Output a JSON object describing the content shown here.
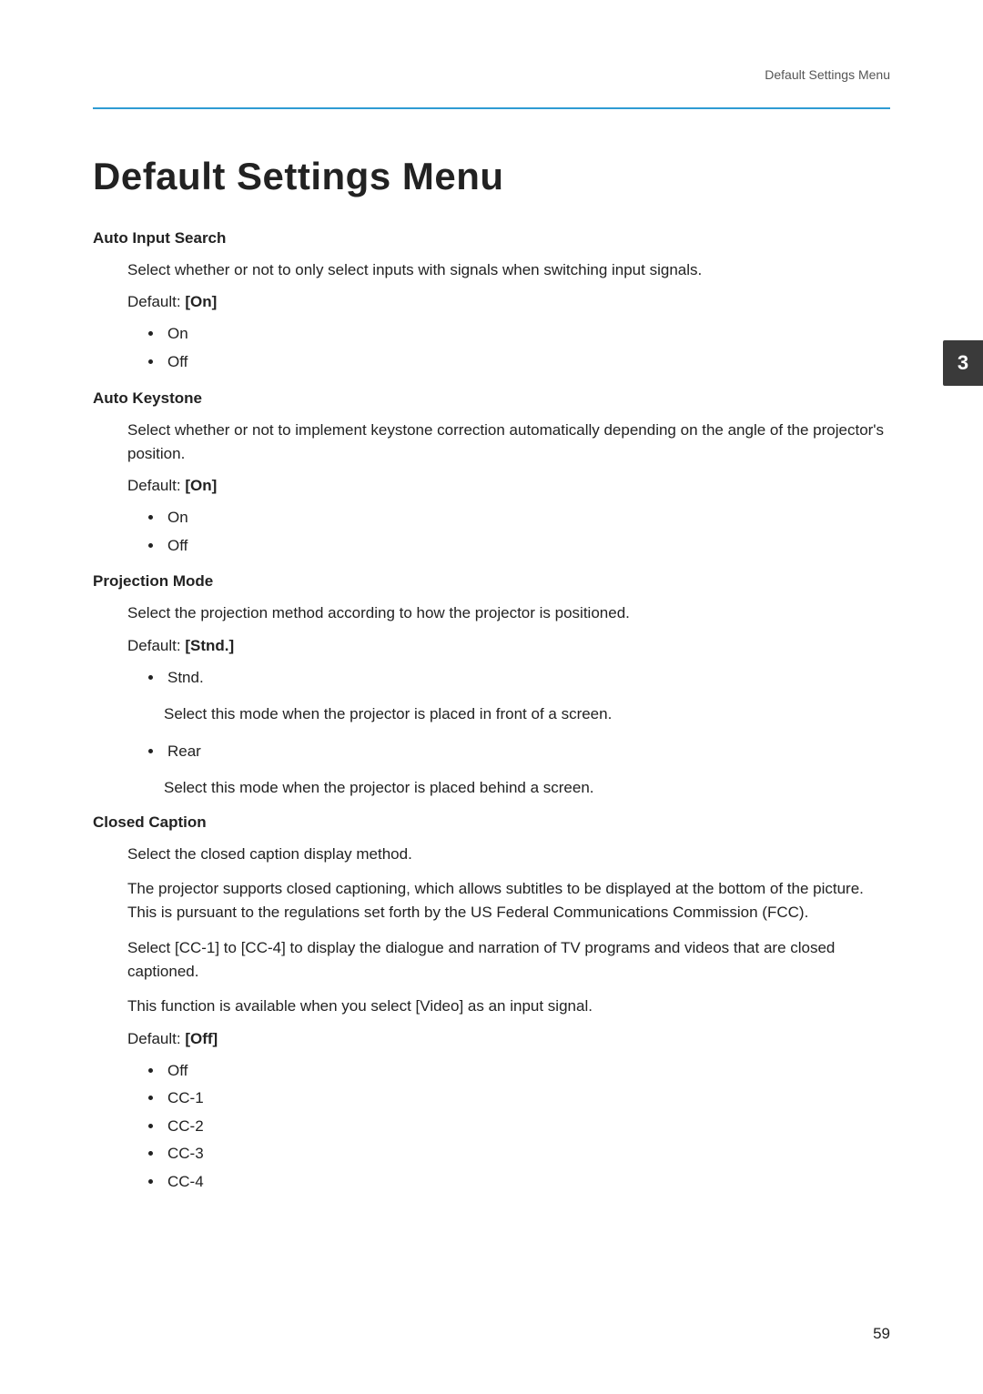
{
  "header": {
    "running_head": "Default Settings Menu"
  },
  "tab": {
    "label": "3"
  },
  "title": "Default Settings Menu",
  "sections": {
    "auto_input_search": {
      "heading": "Auto Input Search",
      "desc": "Select whether or not to only select inputs with signals when switching input signals.",
      "default_label": "Default: ",
      "default_value": "[On]",
      "opts": {
        "o1": "On",
        "o2": "Off"
      }
    },
    "auto_keystone": {
      "heading": "Auto Keystone",
      "desc": "Select whether or not to implement keystone correction automatically depending on the angle of the projector's position.",
      "default_label": "Default: ",
      "default_value": "[On]",
      "opts": {
        "o1": "On",
        "o2": "Off"
      }
    },
    "projection_mode": {
      "heading": "Projection Mode",
      "desc": "Select the projection method according to how the projector is positioned.",
      "default_label": "Default: ",
      "default_value": "[Stnd.]",
      "opts": {
        "o1": "Stnd.",
        "o1_desc": "Select this mode when the projector is placed in front of a screen.",
        "o2": "Rear",
        "o2_desc": "Select this mode when the projector is placed behind a screen."
      }
    },
    "closed_caption": {
      "heading": "Closed Caption",
      "p1": "Select the closed caption display method.",
      "p2": "The projector supports closed captioning, which allows subtitles to be displayed at the bottom of the picture. This is pursuant to the regulations set forth by the US Federal Communications Commission (FCC).",
      "p3": "Select [CC-1] to [CC-4] to display the dialogue and narration of TV programs and videos that are closed captioned.",
      "p4": "This function is available when you select [Video] as an input signal.",
      "default_label": "Default: ",
      "default_value": "[Off]",
      "opts": {
        "o1": "Off",
        "o2": "CC-1",
        "o3": "CC-2",
        "o4": "CC-3",
        "o5": "CC-4"
      }
    }
  },
  "page_number": "59"
}
